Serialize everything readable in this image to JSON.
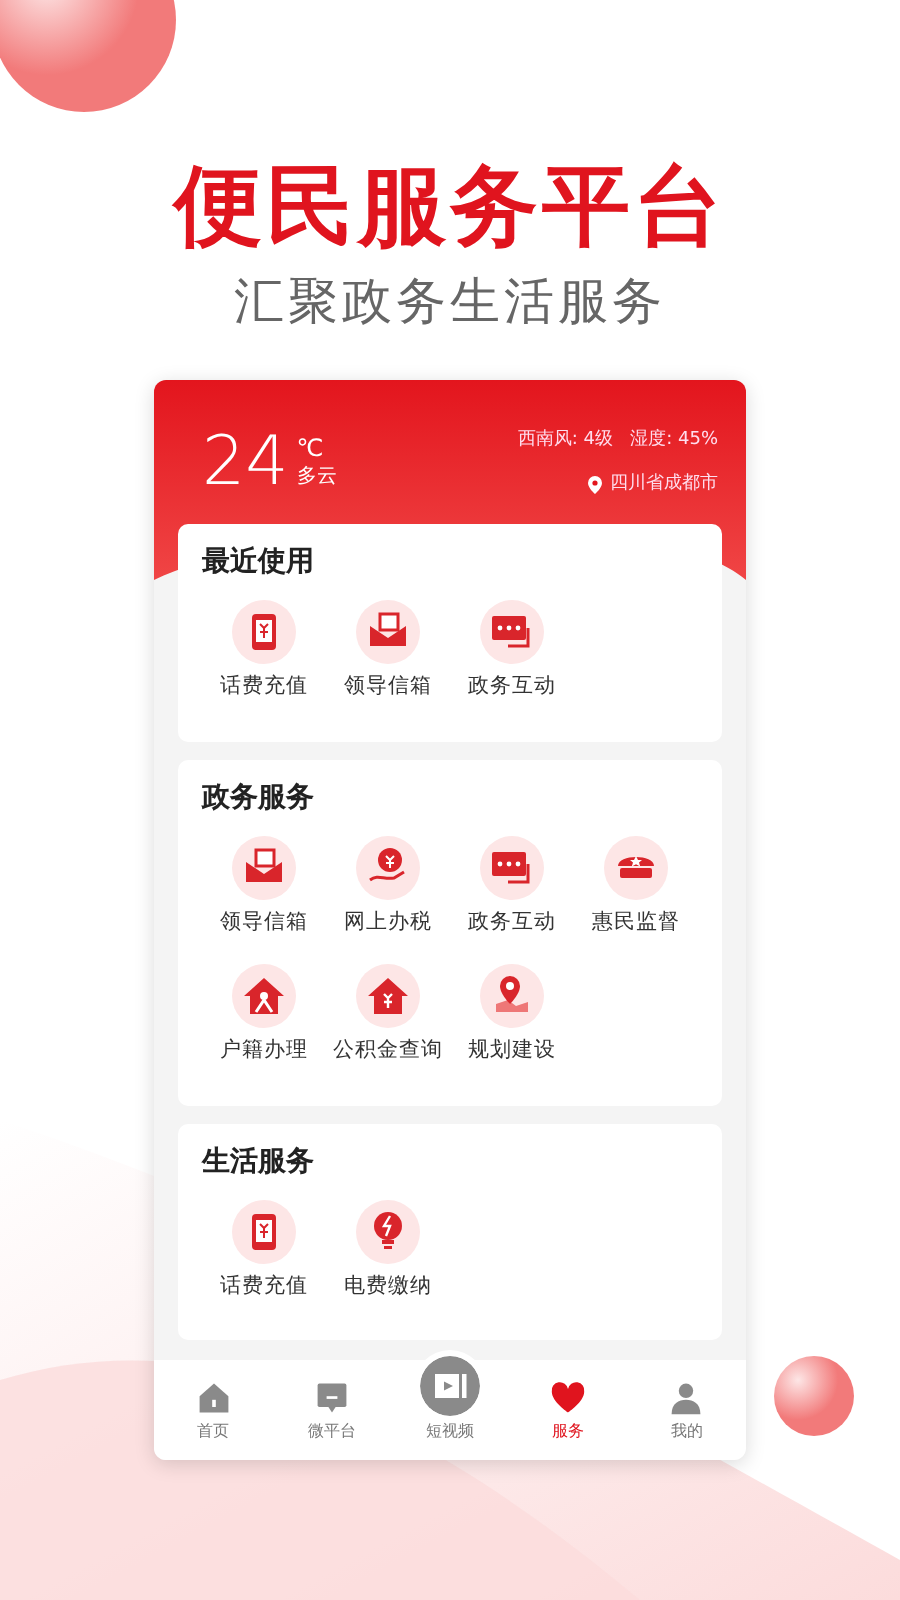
{
  "headline": "便民服务平台",
  "subtitle": "汇聚政务生活服务",
  "weather": {
    "temperature": "24",
    "unit": "℃",
    "condition": "多云",
    "wind_humidity": "西南风: 4级   湿度: 45%",
    "location": "四川省成都市"
  },
  "sections": [
    {
      "title": "最近使用",
      "items": [
        {
          "label": "话费充值",
          "kind": "phone"
        },
        {
          "label": "领导信箱",
          "kind": "mail"
        },
        {
          "label": "政务互动",
          "kind": "chat"
        }
      ]
    },
    {
      "title": "政务服务",
      "items": [
        {
          "label": "领导信箱",
          "kind": "mail"
        },
        {
          "label": "网上办税",
          "kind": "tax"
        },
        {
          "label": "政务互动",
          "kind": "chat"
        },
        {
          "label": "惠民监督",
          "kind": "cap"
        },
        {
          "label": "户籍办理",
          "kind": "house"
        },
        {
          "label": "公积金查询",
          "kind": "fund"
        },
        {
          "label": "规划建设",
          "kind": "plan"
        }
      ]
    },
    {
      "title": "生活服务",
      "items": [
        {
          "label": "话费充值",
          "kind": "phone"
        },
        {
          "label": "电费缴纳",
          "kind": "power"
        }
      ]
    }
  ],
  "tab_bar": [
    {
      "label": "首页",
      "kind": "home",
      "selected": false
    },
    {
      "label": "微平台",
      "kind": "platform",
      "selected": false
    },
    {
      "label": "短视频",
      "kind": "video",
      "selected": false
    },
    {
      "label": "服务",
      "kind": "service",
      "selected": true
    },
    {
      "label": "我的",
      "kind": "profile",
      "selected": false
    }
  ]
}
